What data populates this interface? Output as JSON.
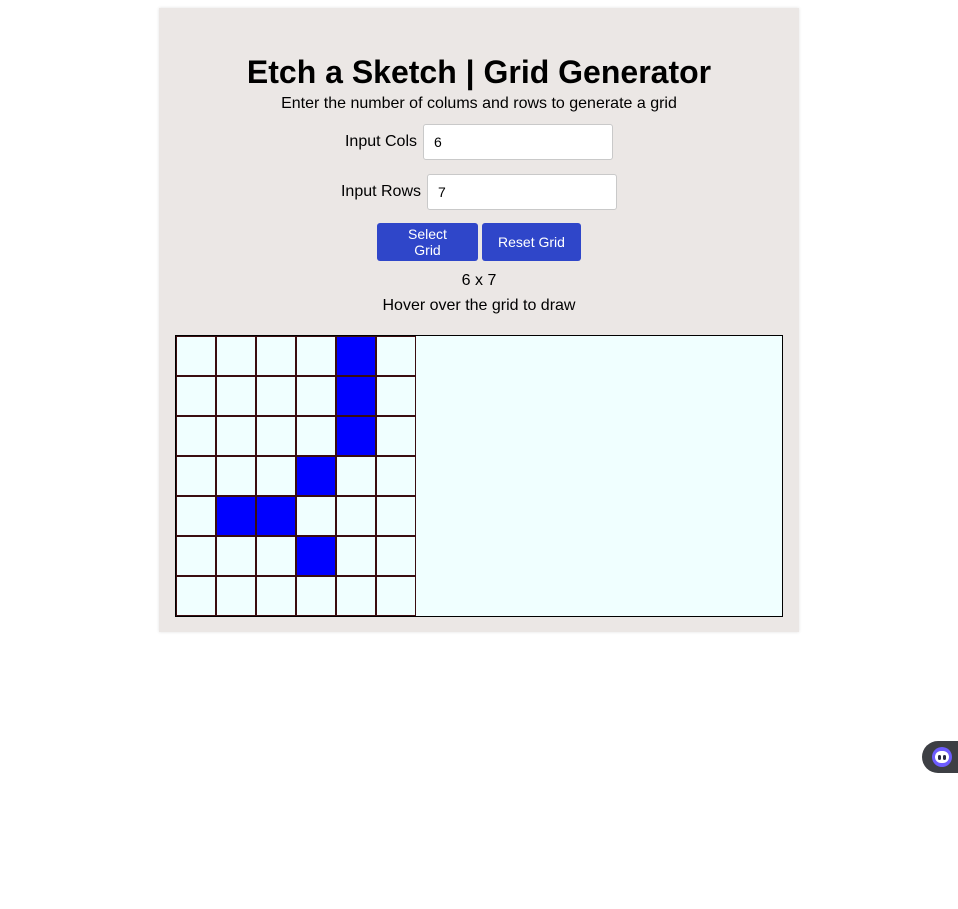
{
  "header": {
    "title": "Etch a Sketch | Grid Generator",
    "subtitle": "Enter the number of colums and rows to generate a grid"
  },
  "form": {
    "cols_label": "Input Cols",
    "cols_value": "6",
    "rows_label": "Input Rows",
    "rows_value": "7"
  },
  "buttons": {
    "select_label": "Select Grid",
    "reset_label": "Reset Grid",
    "color": "#2f46c9"
  },
  "status": {
    "grid_size": "6 x 7",
    "hint": "Hover over the grid to draw"
  },
  "grid": {
    "cols": 6,
    "rows": 7,
    "fill_color": "#0000ff",
    "empty_color": "#f0ffff",
    "filled_cells": [
      [
        0,
        4
      ],
      [
        1,
        4
      ],
      [
        2,
        4
      ],
      [
        3,
        3
      ],
      [
        4,
        1
      ],
      [
        4,
        2
      ],
      [
        5,
        3
      ]
    ]
  },
  "widget": {
    "icon": "assistant-face-icon"
  }
}
